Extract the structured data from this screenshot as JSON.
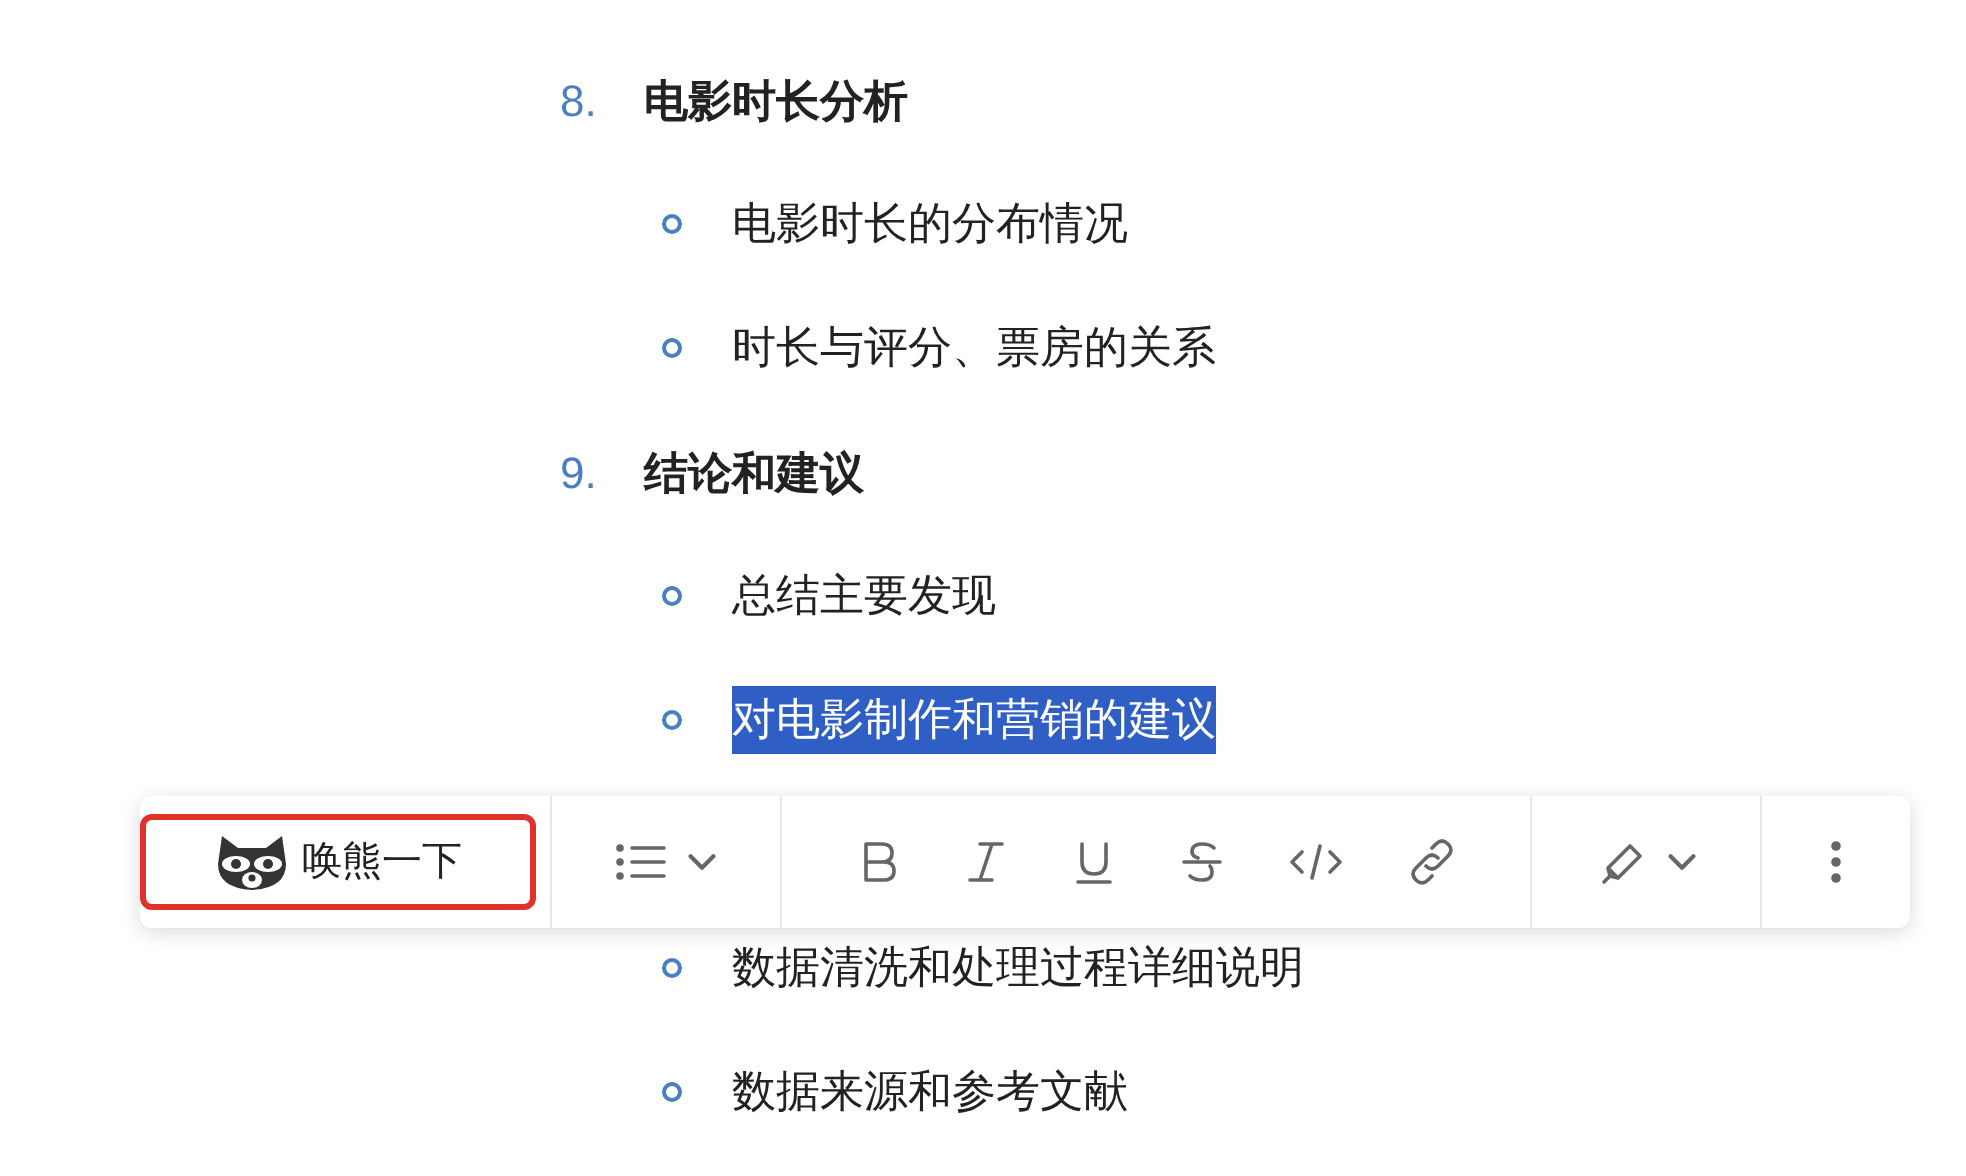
{
  "outline": [
    {
      "kind": "heading",
      "number": "8.",
      "text": "电影时长分析"
    },
    {
      "kind": "bullet",
      "text": "电影时长的分布情况",
      "highlighted": false
    },
    {
      "kind": "bullet",
      "text": "时长与评分、票房的关系",
      "highlighted": false
    },
    {
      "kind": "heading",
      "number": "9.",
      "text": "结论和建议"
    },
    {
      "kind": "bullet",
      "text": "总结主要发现",
      "highlighted": false
    },
    {
      "kind": "bullet",
      "text": "对电影制作和营销的建议",
      "highlighted": true
    },
    {
      "kind": "hidden"
    },
    {
      "kind": "bullet",
      "text": "数据清洗和处理过程详细说明",
      "highlighted": false
    },
    {
      "kind": "bullet",
      "text": "数据来源和参考文献",
      "highlighted": false
    }
  ],
  "toolbar": {
    "ai_button": {
      "label": "唤熊一下",
      "outlined": true
    },
    "tools": [
      {
        "kind": "list"
      },
      {
        "kind": "bold"
      },
      {
        "kind": "italic"
      },
      {
        "kind": "underline"
      },
      {
        "kind": "strikethrough"
      },
      {
        "kind": "code"
      },
      {
        "kind": "link"
      },
      {
        "kind": "highlighter"
      },
      {
        "kind": "more"
      }
    ]
  }
}
